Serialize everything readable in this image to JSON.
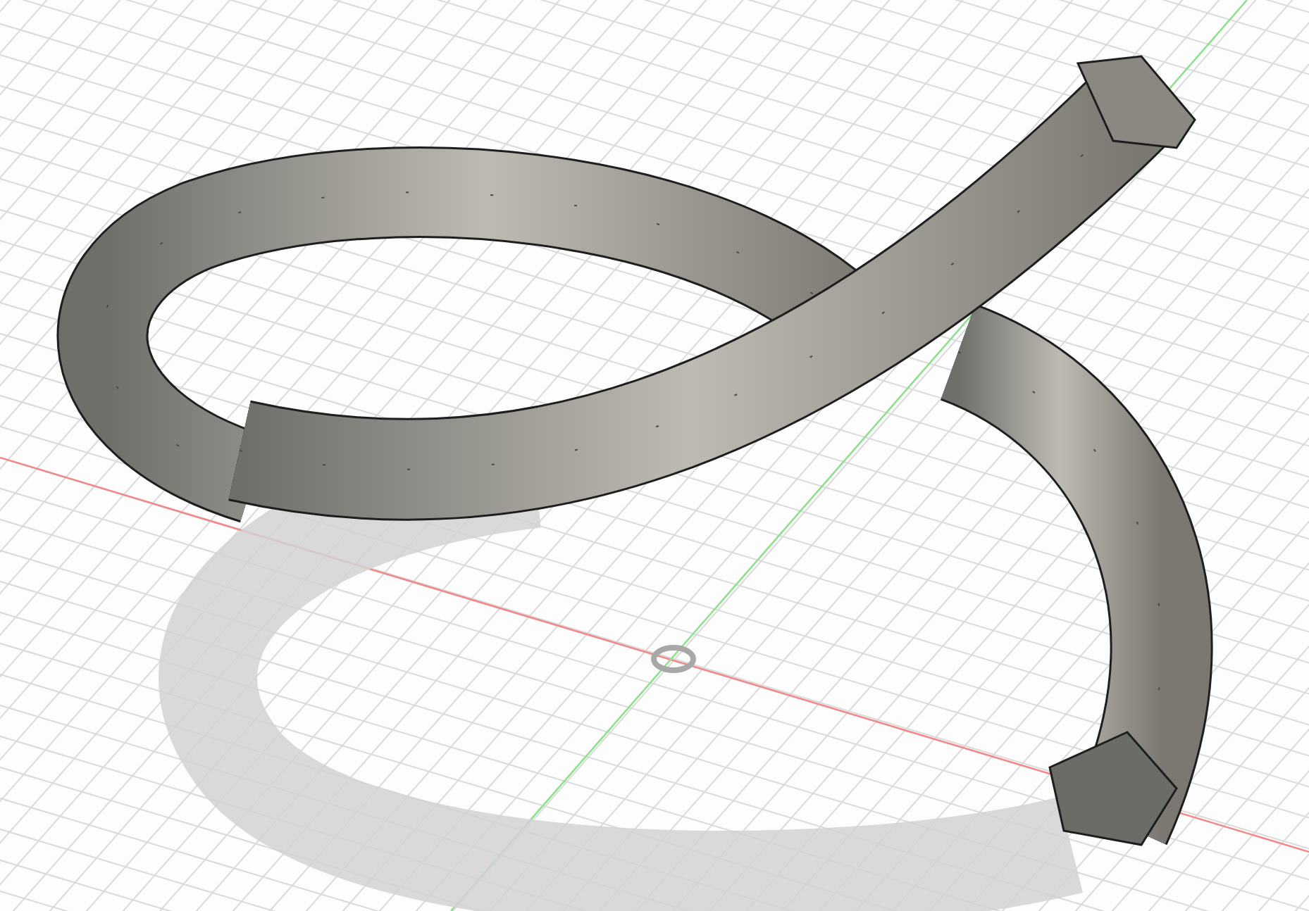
{
  "viewport": {
    "grid": true,
    "axes": true,
    "shadow": true
  }
}
